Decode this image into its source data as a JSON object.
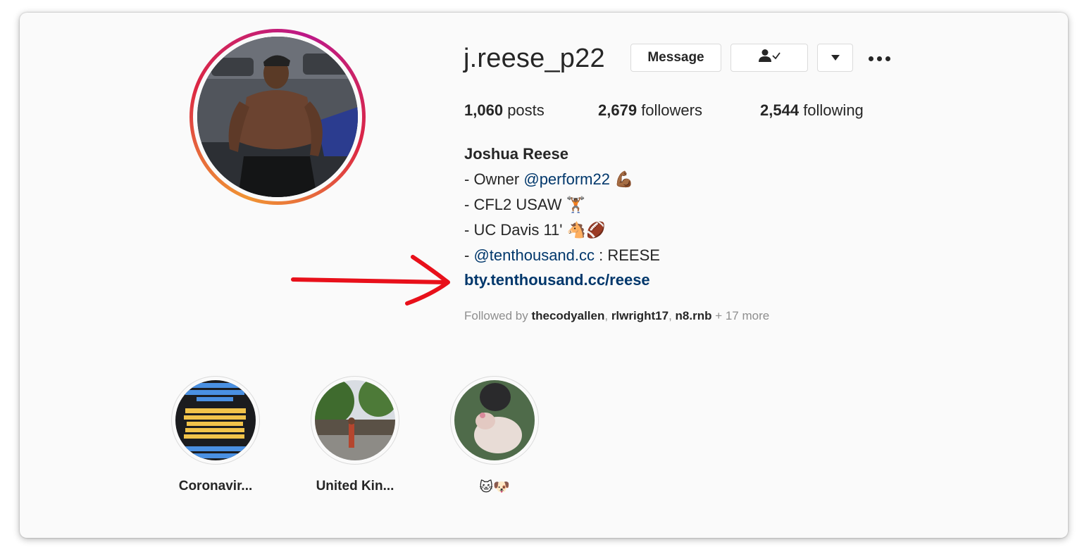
{
  "profile": {
    "username": "j.reese_p22",
    "message_label": "Message",
    "following_icon": "person-check-icon",
    "dropdown_icon": "caret-down-icon",
    "more_icon": "more-dots-icon",
    "stats": {
      "posts_count": "1,060",
      "posts_label": "posts",
      "followers_count": "2,679",
      "followers_label": "followers",
      "following_count": "2,544",
      "following_label": "following"
    },
    "full_name": "Joshua Reese",
    "bio": {
      "line1_prefix": "- Owner ",
      "line1_mention": "@perform22",
      "line1_emoji": "💪🏾",
      "line2": "- CFL2 USAW 🏋🏾",
      "line3": "- UC Davis 11' 🐴🏈",
      "line4_prefix": "- ",
      "line4_mention": "@tenthousand.cc",
      "line4_suffix": " : REESE"
    },
    "link": "bty.tenthousand.cc/reese",
    "followed_by": {
      "prefix": "Followed by ",
      "names": [
        "thecodyallen",
        "rlwright17",
        "n8.rnb"
      ],
      "separator": ", ",
      "more": " + 17 more"
    }
  },
  "highlights": [
    {
      "label": "Coronavir..."
    },
    {
      "label": "United Kin..."
    },
    {
      "label": "🐱🐶"
    }
  ],
  "colors": {
    "link": "#00376b",
    "text": "#262626",
    "muted": "#8e8e8e",
    "arrow": "#e8101a",
    "background": "#fafafa"
  }
}
